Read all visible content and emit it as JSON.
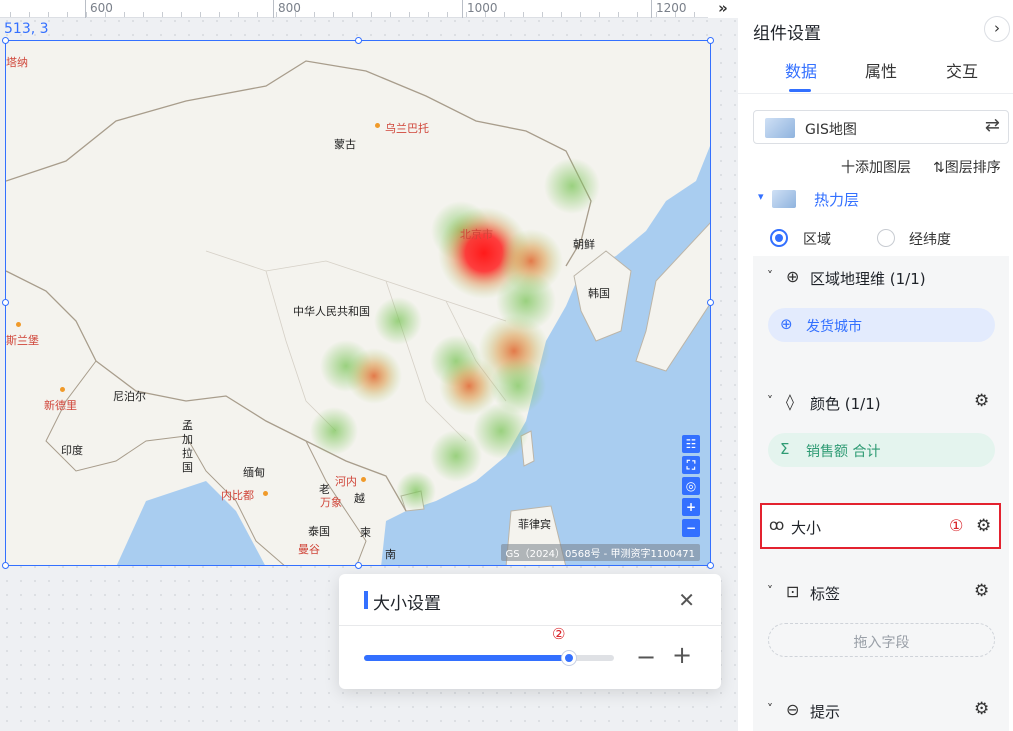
{
  "canvas": {
    "ruler": {
      "ticks": [
        "600",
        "800",
        "1000",
        "1200"
      ],
      "expand_icon": "double-chevron-right-icon",
      "expand_glyph": "»"
    },
    "coordinate_readout": "513, 3",
    "map": {
      "labels": {
        "partial_left": "塔纳",
        "mongolia": "蒙古",
        "ulaanbaatar": "乌兰巴托",
        "beijing": "北京市",
        "north_korea": "朝鲜",
        "south_korea": "韩国",
        "china": "中华人民共和国",
        "sri_lanka_partial": "斯兰堡",
        "nepal": "尼泊尔",
        "new_delhi": "新德里",
        "india": "印度",
        "bangladesh": "孟加拉国",
        "myanmar": "缅甸",
        "naypyidaw": "内比都",
        "hanoi": "河内",
        "laos": "老",
        "vientiane": "万象",
        "vietnam": "越",
        "thailand": "泰国",
        "cambodia": "柬",
        "bangkok": "曼谷",
        "philippines": "菲律宾",
        "south_partial": "南"
      },
      "tools": [
        {
          "name": "legend-list-icon",
          "glyph": "☷"
        },
        {
          "name": "frame-select-icon",
          "glyph": "⛶"
        },
        {
          "name": "locate-icon",
          "glyph": "◎"
        },
        {
          "name": "zoom-in-icon",
          "glyph": "+"
        },
        {
          "name": "zoom-out-icon",
          "glyph": "−"
        }
      ],
      "attribution": "GS（2024）0568号 - 甲测资字1100471"
    },
    "size_popup": {
      "title": "大小设置",
      "close_glyph": "✕",
      "step_marker": "②",
      "slider_value": 0.82,
      "minus_glyph": "−",
      "plus_glyph": "+"
    }
  },
  "panel": {
    "title": "组件设置",
    "collapse_glyph": "›",
    "tabs": [
      "数据",
      "属性",
      "交互"
    ],
    "active_tab": 0,
    "map_type": {
      "label": "GIS地图",
      "swap_glyph": "⇄"
    },
    "add_layer": "十添加图层",
    "sort_layer": "⇅图层排序",
    "layer": {
      "caret": "▾",
      "name": "热力层"
    },
    "radio_options": [
      "区域",
      "经纬度"
    ],
    "radio_selected": 0,
    "sections": {
      "region_dim": {
        "caret": "˅",
        "icon": "globe-icon",
        "glyph": "⊕",
        "label": "区域地理维 (1/1)",
        "field": {
          "icon": "globe-icon",
          "glyph": "⊕",
          "label": "发货城市"
        }
      },
      "color": {
        "caret": "˅",
        "icon": "droplet-icon",
        "glyph": "◊",
        "label": "颜色 (1/1)",
        "gear": "⚙",
        "field": {
          "icon": "sigma-icon",
          "glyph": "Σ",
          "label": "销售额 合计"
        }
      },
      "size": {
        "icon": "size-dots-icon",
        "glyph": "ꝏ",
        "label": "大小",
        "step_marker": "①",
        "gear": "⚙"
      },
      "tag": {
        "caret": "˅",
        "icon": "tag-box-icon",
        "glyph": "⊡",
        "label": "标签",
        "gear": "⚙",
        "drop_placeholder": "拖入字段"
      },
      "tooltip": {
        "caret": "˅",
        "icon": "chat-bubble-icon",
        "glyph": "⊖",
        "label": "提示",
        "gear": "⚙"
      }
    }
  },
  "colors": {
    "accent": "#3370ff",
    "highlight_border": "#e3222f",
    "step_number": "#d9262b",
    "region_pill": "#e3ebfd",
    "measure_pill": "#e4f4ee",
    "measure_text": "#2f9b74"
  }
}
